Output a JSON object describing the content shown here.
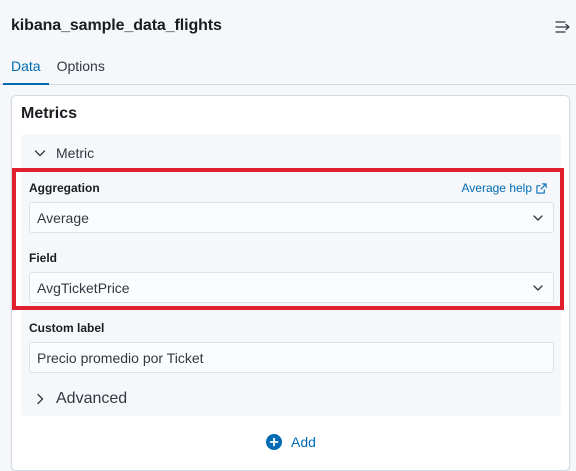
{
  "header": {
    "title": "kibana_sample_data_flights"
  },
  "tabs": [
    {
      "label": "Data",
      "active": true
    },
    {
      "label": "Options",
      "active": false
    }
  ],
  "metrics": {
    "section_title": "Metrics",
    "group_label": "Metric",
    "aggregation": {
      "label": "Aggregation",
      "help_link": "Average help",
      "selected": "Average"
    },
    "field": {
      "label": "Field",
      "selected": "AvgTicketPrice"
    },
    "custom_label": {
      "label": "Custom label",
      "value": "Precio promedio por Ticket"
    },
    "advanced_label": "Advanced",
    "add_label": "Add"
  },
  "colors": {
    "accent": "#006bb4",
    "highlight_border": "#e0202e"
  }
}
